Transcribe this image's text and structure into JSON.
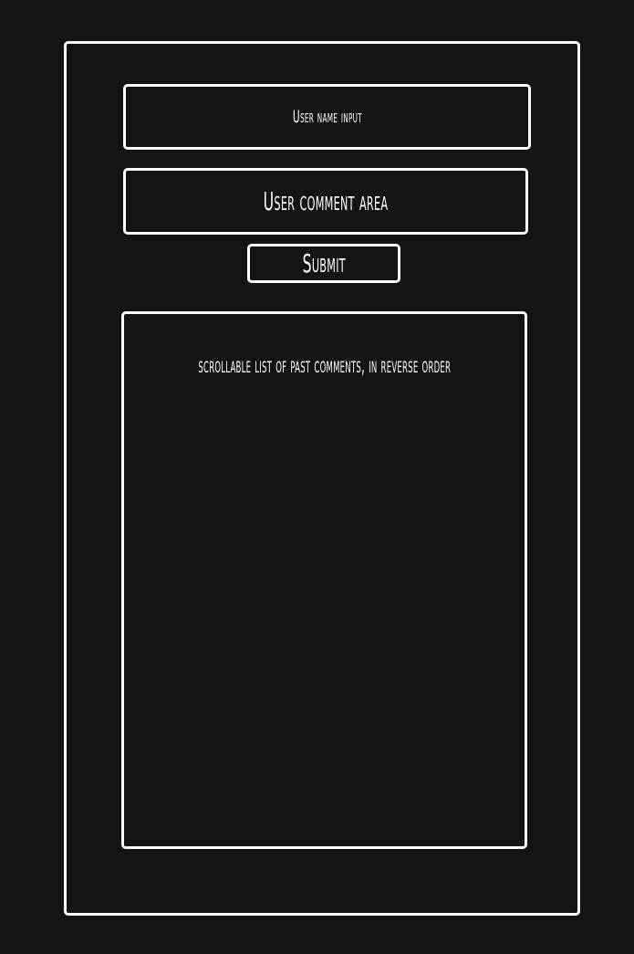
{
  "form": {
    "username_input_label": "User name input",
    "comment_area_label": "User comment area",
    "submit_label": "Submit"
  },
  "comments": {
    "list_label": "scrollable list of past comments, in reverse order"
  },
  "colors": {
    "background": "#141414",
    "stroke": "#ffffff",
    "text": "#ffffff"
  }
}
